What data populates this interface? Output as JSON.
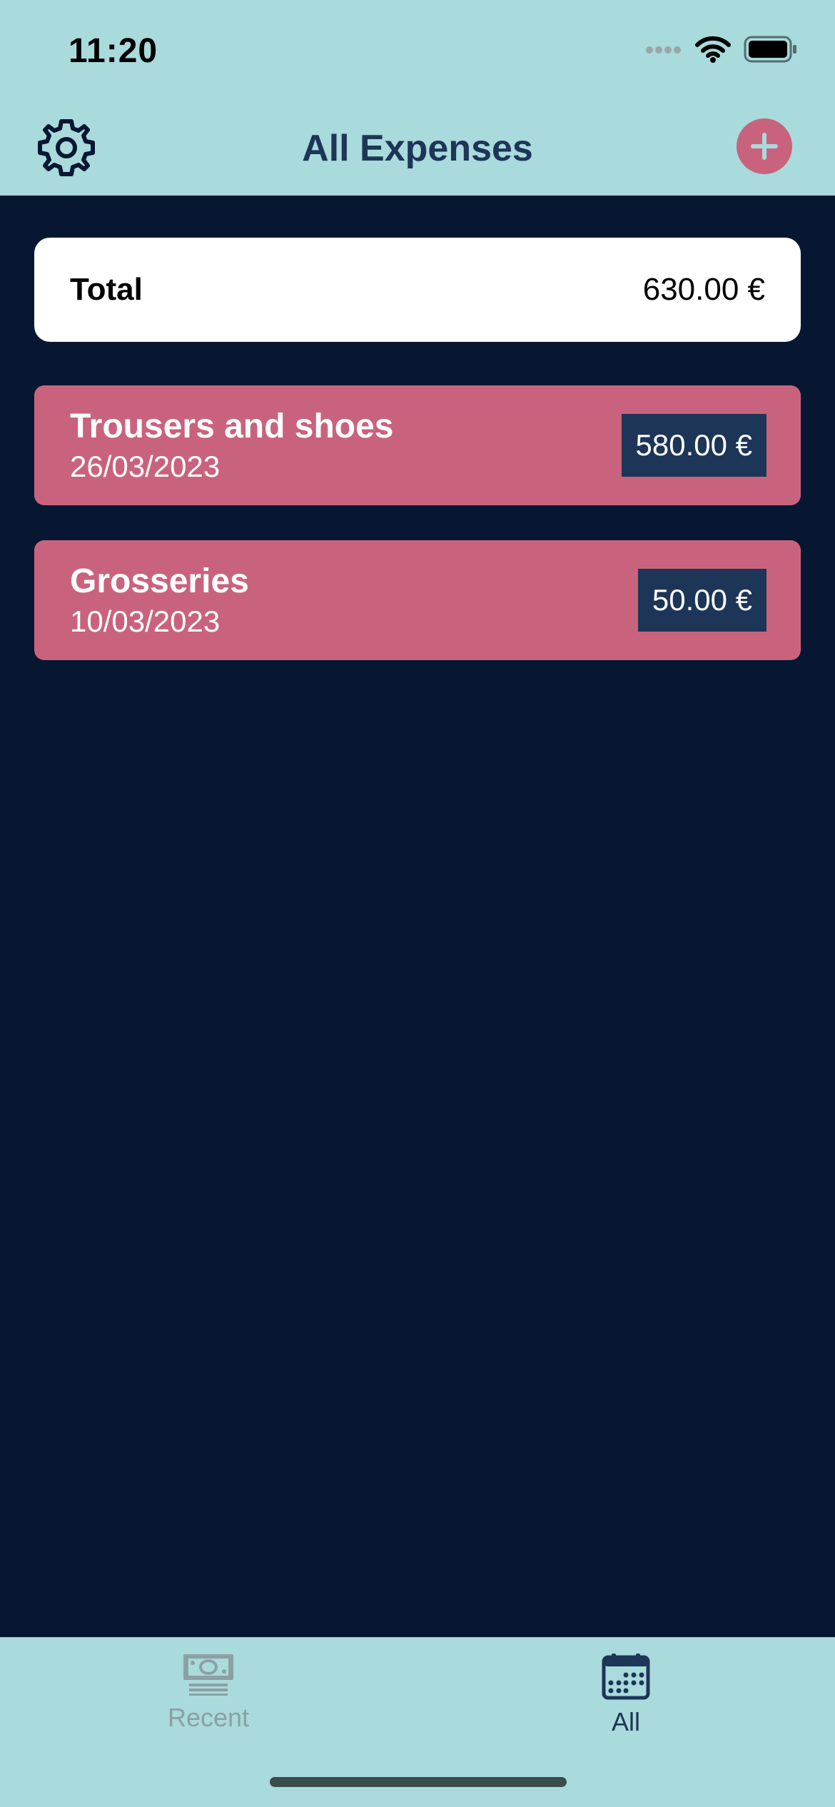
{
  "status_bar": {
    "time": "11:20",
    "icons": [
      "signal-icon",
      "wifi-icon",
      "battery-icon"
    ]
  },
  "header": {
    "title": "All Expenses",
    "left_icon": "gear-icon",
    "right_icon": "plus-icon"
  },
  "summary": {
    "label": "Total",
    "value": "630.00 €"
  },
  "expenses": [
    {
      "description": "Trousers and shoes",
      "date": "26/03/2023",
      "amount": "580.00 €"
    },
    {
      "description": "Grosseries",
      "date": "10/03/2023",
      "amount": "50.00 €"
    }
  ],
  "tabs": [
    {
      "label": "Recent",
      "icon": "money-bills-icon",
      "active": false
    },
    {
      "label": "All",
      "icon": "calendar-icon",
      "active": true
    }
  ],
  "colors": {
    "header_bg": "#A9DADC",
    "background": "#081731",
    "accent": "#C9637D",
    "amount_bg": "#1D3557",
    "title": "#1D3557",
    "inactive_tab": "#8BA0A5"
  }
}
